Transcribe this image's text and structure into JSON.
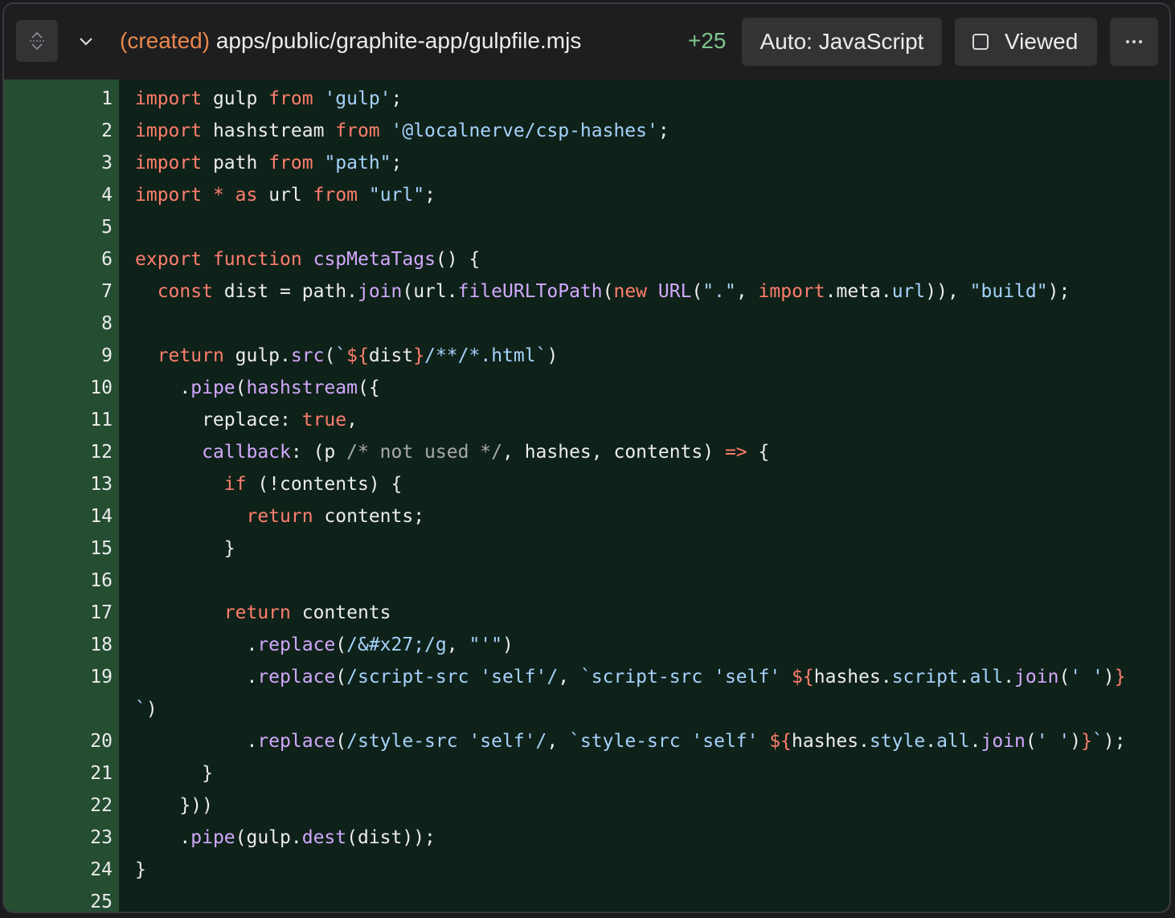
{
  "header": {
    "file_status": "(created)",
    "file_path": "apps/public/graphite-app/gulpfile.mjs",
    "added_count": "+25",
    "language_label": "Auto: JavaScript",
    "viewed_label": "Viewed",
    "more_label": "···"
  },
  "colors": {
    "gutter_bg": "#244d32",
    "code_bg": "#0f2219",
    "keyword": "#ff7e6d",
    "string": "#a6d2ff",
    "function": "#d2a8ff",
    "status_created": "#e8884a",
    "added": "#7dc68a"
  },
  "icons": {
    "expand": "expand-collapse-icon",
    "collapse": "chevron-down-icon",
    "checkbox": "checkbox-icon",
    "more": "more-horizontal-icon"
  },
  "code": {
    "language": "javascript",
    "lines": [
      {
        "num": "1",
        "tokens": [
          [
            "kw",
            "import"
          ],
          [
            "p",
            " gulp "
          ],
          [
            "kw",
            "from"
          ],
          [
            "p",
            " "
          ],
          [
            "str",
            "'gulp'"
          ],
          [
            "p",
            ";"
          ]
        ]
      },
      {
        "num": "2",
        "tokens": [
          [
            "kw",
            "import"
          ],
          [
            "p",
            " hashstream "
          ],
          [
            "kw",
            "from"
          ],
          [
            "p",
            " "
          ],
          [
            "str",
            "'@localnerve/csp-hashes'"
          ],
          [
            "p",
            ";"
          ]
        ]
      },
      {
        "num": "3",
        "tokens": [
          [
            "kw",
            "import"
          ],
          [
            "p",
            " path "
          ],
          [
            "kw",
            "from"
          ],
          [
            "p",
            " "
          ],
          [
            "str",
            "\"path\""
          ],
          [
            "p",
            ";"
          ]
        ]
      },
      {
        "num": "4",
        "tokens": [
          [
            "kw",
            "import"
          ],
          [
            "p",
            " "
          ],
          [
            "kw",
            "*"
          ],
          [
            "p",
            " "
          ],
          [
            "kw",
            "as"
          ],
          [
            "p",
            " url "
          ],
          [
            "kw",
            "from"
          ],
          [
            "p",
            " "
          ],
          [
            "str",
            "\"url\""
          ],
          [
            "p",
            ";"
          ]
        ]
      },
      {
        "num": "5",
        "tokens": []
      },
      {
        "num": "6",
        "tokens": [
          [
            "kw",
            "export"
          ],
          [
            "p",
            " "
          ],
          [
            "kw",
            "function"
          ],
          [
            "p",
            " "
          ],
          [
            "fn",
            "cspMetaTags"
          ],
          [
            "p",
            "() {"
          ]
        ]
      },
      {
        "num": "7",
        "tokens": [
          [
            "p",
            "  "
          ],
          [
            "kw",
            "const"
          ],
          [
            "p",
            " dist = path."
          ],
          [
            "fn",
            "join"
          ],
          [
            "p",
            "(url."
          ],
          [
            "fn",
            "fileURLToPath"
          ],
          [
            "p",
            "("
          ],
          [
            "kw",
            "new"
          ],
          [
            "p",
            " "
          ],
          [
            "fn",
            "URL"
          ],
          [
            "p",
            "("
          ],
          [
            "str",
            "\".\""
          ],
          [
            "p",
            ", "
          ],
          [
            "kw",
            "import"
          ],
          [
            "p",
            ".meta."
          ],
          [
            "str",
            "url"
          ],
          [
            "p",
            ")), "
          ],
          [
            "str",
            "\"build\""
          ],
          [
            "p",
            ");"
          ]
        ]
      },
      {
        "num": "8",
        "tokens": []
      },
      {
        "num": "9",
        "tokens": [
          [
            "p",
            "  "
          ],
          [
            "kw",
            "return"
          ],
          [
            "p",
            " gulp."
          ],
          [
            "fn",
            "src"
          ],
          [
            "p",
            "("
          ],
          [
            "str",
            "`"
          ],
          [
            "kw",
            "${"
          ],
          [
            "p",
            "dist"
          ],
          [
            "kw",
            "}"
          ],
          [
            "str",
            "/**/*.html`"
          ],
          [
            "p",
            ")"
          ]
        ]
      },
      {
        "num": "10",
        "tokens": [
          [
            "p",
            "    ."
          ],
          [
            "fn",
            "pipe"
          ],
          [
            "p",
            "("
          ],
          [
            "fn",
            "hashstream"
          ],
          [
            "p",
            "({"
          ]
        ]
      },
      {
        "num": "11",
        "tokens": [
          [
            "p",
            "      replace: "
          ],
          [
            "kw",
            "true"
          ],
          [
            "p",
            ","
          ]
        ]
      },
      {
        "num": "12",
        "tokens": [
          [
            "p",
            "      "
          ],
          [
            "fn",
            "callback"
          ],
          [
            "p",
            ": (p "
          ],
          [
            "cm",
            "/* not used */"
          ],
          [
            "p",
            ", hashes, contents) "
          ],
          [
            "kw",
            "=>"
          ],
          [
            "p",
            " {"
          ]
        ]
      },
      {
        "num": "13",
        "tokens": [
          [
            "p",
            "        "
          ],
          [
            "kw",
            "if"
          ],
          [
            "p",
            " (!contents) {"
          ]
        ]
      },
      {
        "num": "14",
        "tokens": [
          [
            "p",
            "          "
          ],
          [
            "kw",
            "return"
          ],
          [
            "p",
            " contents;"
          ]
        ]
      },
      {
        "num": "15",
        "tokens": [
          [
            "p",
            "        }"
          ]
        ]
      },
      {
        "num": "16",
        "tokens": []
      },
      {
        "num": "17",
        "tokens": [
          [
            "p",
            "        "
          ],
          [
            "kw",
            "return"
          ],
          [
            "p",
            " contents"
          ]
        ]
      },
      {
        "num": "18",
        "tokens": [
          [
            "p",
            "          ."
          ],
          [
            "fn",
            "replace"
          ],
          [
            "p",
            "("
          ],
          [
            "str",
            "/&#x27;/g"
          ],
          [
            "p",
            ", "
          ],
          [
            "str",
            "\"'\""
          ],
          [
            "p",
            ")"
          ]
        ]
      },
      {
        "num": "19",
        "tokens": [
          [
            "p",
            "          ."
          ],
          [
            "fn",
            "replace"
          ],
          [
            "p",
            "("
          ],
          [
            "str",
            "/script-src 'self'/"
          ],
          [
            "p",
            ", "
          ],
          [
            "str",
            "`script-src 'self' "
          ],
          [
            "kw",
            "${"
          ],
          [
            "p",
            "hashes."
          ],
          [
            "str",
            "script"
          ],
          [
            "p",
            "."
          ],
          [
            "str",
            "all"
          ],
          [
            "p",
            "."
          ],
          [
            "fn",
            "join"
          ],
          [
            "p",
            "("
          ],
          [
            "str",
            "' '"
          ],
          [
            "p",
            ")"
          ],
          [
            "kw",
            "}"
          ]
        ]
      },
      {
        "num": "",
        "tokens": [
          [
            "str",
            "`"
          ],
          [
            "p",
            ")"
          ]
        ]
      },
      {
        "num": "20",
        "tokens": [
          [
            "p",
            "          ."
          ],
          [
            "fn",
            "replace"
          ],
          [
            "p",
            "("
          ],
          [
            "str",
            "/style-src 'self'/"
          ],
          [
            "p",
            ", "
          ],
          [
            "str",
            "`style-src 'self' "
          ],
          [
            "kw",
            "${"
          ],
          [
            "p",
            "hashes."
          ],
          [
            "str",
            "style"
          ],
          [
            "p",
            "."
          ],
          [
            "str",
            "all"
          ],
          [
            "p",
            "."
          ],
          [
            "fn",
            "join"
          ],
          [
            "p",
            "("
          ],
          [
            "str",
            "' '"
          ],
          [
            "p",
            ")"
          ],
          [
            "kw",
            "}"
          ],
          [
            "str",
            "`"
          ],
          [
            "p",
            ");"
          ]
        ]
      },
      {
        "num": "21",
        "tokens": [
          [
            "p",
            "      }"
          ]
        ]
      },
      {
        "num": "22",
        "tokens": [
          [
            "p",
            "    }))"
          ]
        ]
      },
      {
        "num": "23",
        "tokens": [
          [
            "p",
            "    ."
          ],
          [
            "fn",
            "pipe"
          ],
          [
            "p",
            "(gulp."
          ],
          [
            "fn",
            "dest"
          ],
          [
            "p",
            "(dist));"
          ]
        ]
      },
      {
        "num": "24",
        "tokens": [
          [
            "p",
            "}"
          ]
        ]
      },
      {
        "num": "25",
        "tokens": []
      }
    ]
  }
}
